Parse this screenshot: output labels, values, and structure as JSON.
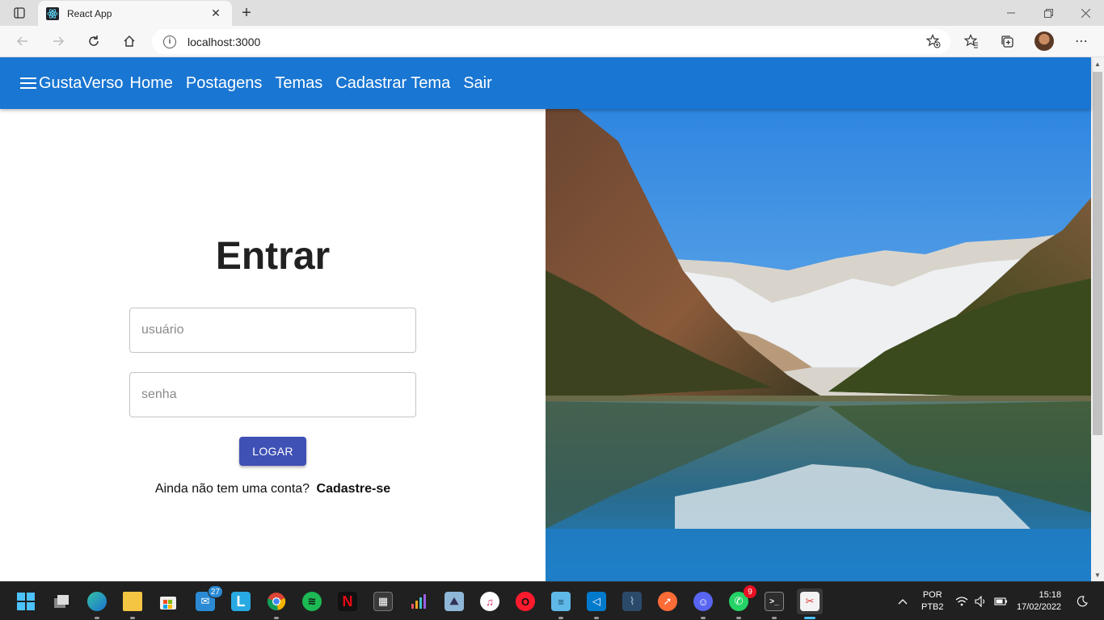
{
  "browser": {
    "tab_title": "React App",
    "url": "localhost:3000"
  },
  "app": {
    "brand": "GustaVerso",
    "nav": [
      "Home",
      "Postagens",
      "Temas",
      "Cadastrar Tema",
      "Sair"
    ],
    "login": {
      "title": "Entrar",
      "username_placeholder": "usuário",
      "password_placeholder": "senha",
      "submit_label": "LOGAR",
      "signup_prompt": "Ainda não tem uma conta?",
      "signup_link": "Cadastre-se"
    }
  },
  "colors": {
    "appbar": "#1976d2",
    "button": "#3f51b5"
  },
  "taskbar": {
    "icons": [
      "windows-start-icon",
      "task-view-icon",
      "edge-icon",
      "file-explorer-icon",
      "store-icon",
      "mail-icon",
      "l-app-icon",
      "chrome-icon",
      "spotify-icon",
      "netflix-icon",
      "calculator-icon",
      "deezer-icon",
      "photos-icon",
      "itunes-icon",
      "opera-icon",
      "notepad-icon",
      "vscode-icon",
      "mysql-workbench-icon",
      "postman-icon",
      "discord-icon",
      "whatsapp-icon",
      "terminal-icon",
      "snipping-tool-icon"
    ],
    "mail_badge": "27",
    "whatsapp_badge": "9",
    "lang_top": "POR",
    "lang_bottom": "PTB2",
    "time": "15:18",
    "date": "17/02/2022"
  }
}
